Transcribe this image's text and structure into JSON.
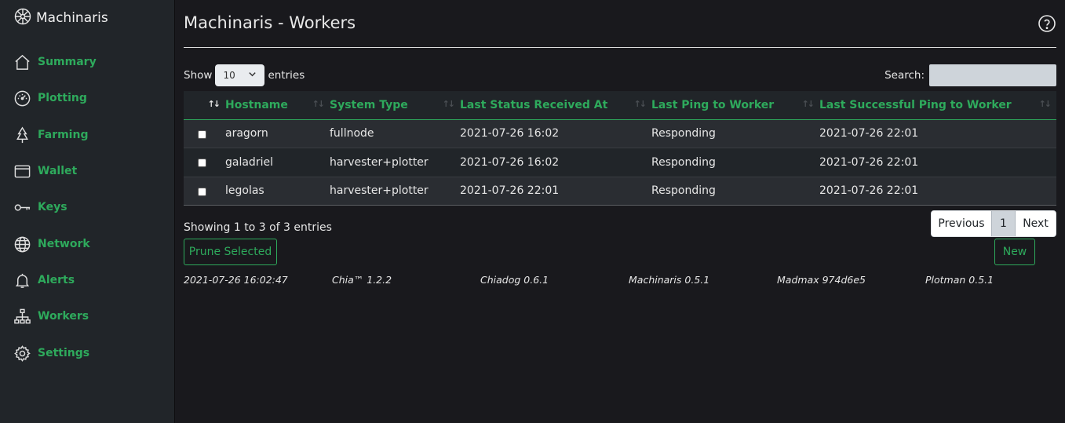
{
  "brand": {
    "name": "Machinaris"
  },
  "sidebar": {
    "items": [
      {
        "label": "Summary",
        "icon": "house-icon"
      },
      {
        "label": "Plotting",
        "icon": "speedometer-icon"
      },
      {
        "label": "Farming",
        "icon": "tree-icon"
      },
      {
        "label": "Wallet",
        "icon": "wallet-icon"
      },
      {
        "label": "Keys",
        "icon": "key-icon"
      },
      {
        "label": "Network",
        "icon": "globe-icon"
      },
      {
        "label": "Alerts",
        "icon": "bell-icon"
      },
      {
        "label": "Workers",
        "icon": "diagram-icon"
      },
      {
        "label": "Settings",
        "icon": "gear-icon"
      }
    ]
  },
  "header": {
    "title": "Machinaris - Workers",
    "help_icon": "question-circle-icon"
  },
  "table_controls": {
    "show_label": "Show",
    "entries_value": "10",
    "entries_label": "entries",
    "search_label": "Search:",
    "search_value": ""
  },
  "table": {
    "columns": [
      "Hostname",
      "System Type",
      "Last Status Received At",
      "Last Ping to Worker",
      "Last Successful Ping to Worker"
    ],
    "rows": [
      {
        "hostname": "aragorn",
        "system_type": "fullnode",
        "last_status": "2021-07-26 16:02",
        "last_ping": "Responding",
        "last_success": "2021-07-26 22:01"
      },
      {
        "hostname": "galadriel",
        "system_type": "harvester+plotter",
        "last_status": "2021-07-26 16:02",
        "last_ping": "Responding",
        "last_success": "2021-07-26 22:01"
      },
      {
        "hostname": "legolas",
        "system_type": "harvester+plotter",
        "last_status": "2021-07-26 22:01",
        "last_ping": "Responding",
        "last_success": "2021-07-26 22:01"
      }
    ]
  },
  "info": {
    "text": "Showing 1 to 3 of 3 entries"
  },
  "pagination": {
    "previous": "Previous",
    "current": "1",
    "next": "Next"
  },
  "buttons": {
    "prune": "Prune Selected",
    "new": "New"
  },
  "footer": {
    "timestamp": "2021-07-26 16:02:47",
    "chia": "Chia™ 1.2.2",
    "chiadog": "Chiadog 0.6.1",
    "machinaris": "Machinaris 0.5.1",
    "madmax": "Madmax 974d6e5",
    "plotman": "Plotman 0.5.1"
  },
  "colors": {
    "accent": "#2eaa5c",
    "background": "#19191d",
    "sidebar": "#212529"
  }
}
